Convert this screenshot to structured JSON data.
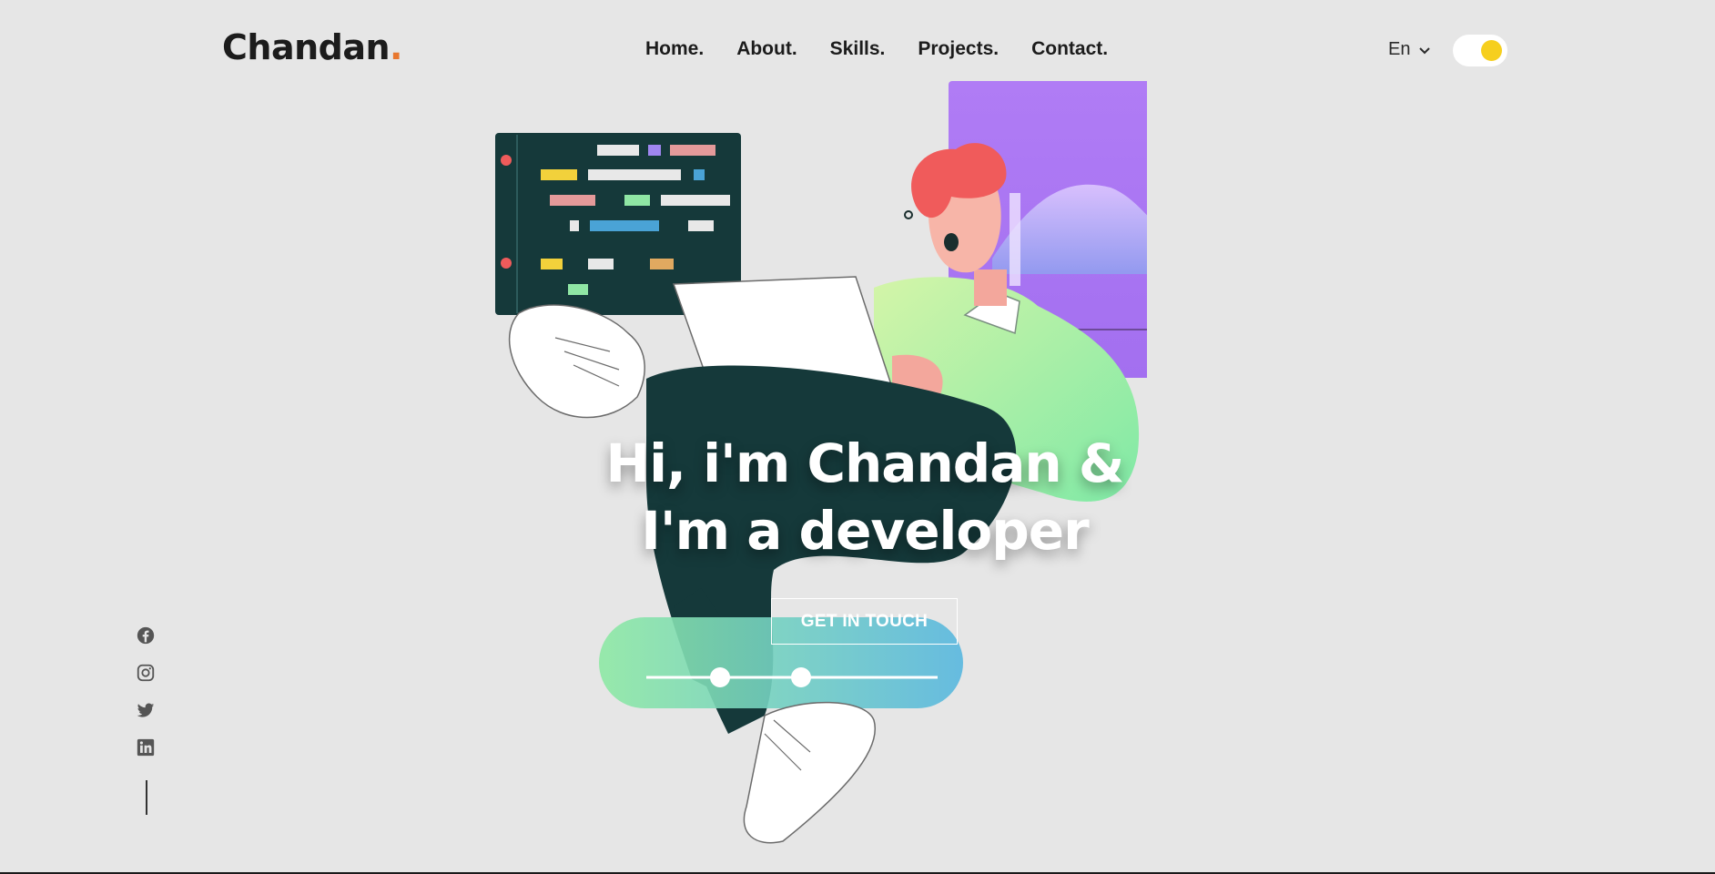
{
  "header": {
    "logo_text": "Chandan",
    "logo_dot": ".",
    "nav": [
      {
        "label": "Home."
      },
      {
        "label": "About."
      },
      {
        "label": "Skills."
      },
      {
        "label": "Projects."
      },
      {
        "label": "Contact."
      }
    ],
    "language": {
      "value": "En",
      "icon": "chevron-down-icon"
    },
    "theme_toggle": {
      "state": "on"
    }
  },
  "hero": {
    "title_line1": "Hi, i'm Chandan &",
    "title_line2": "I'm a developer",
    "cta_label": "GET IN TOUCH"
  },
  "socials": [
    {
      "icon": "facebook-icon"
    },
    {
      "icon": "instagram-icon"
    },
    {
      "icon": "twitter-icon"
    },
    {
      "icon": "linkedin-icon"
    }
  ],
  "colors": {
    "background": "#e6e6e6",
    "accent_orange": "#e8772e",
    "toggle_knob": "#f6cf1e",
    "text_dark": "#1c1c1c"
  }
}
